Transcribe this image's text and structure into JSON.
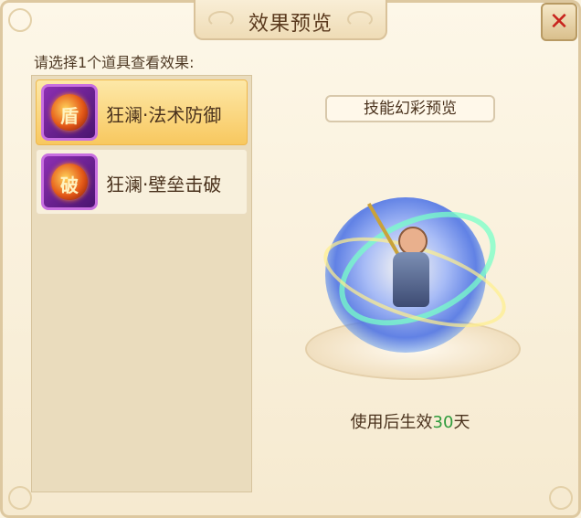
{
  "dialog": {
    "title": "效果预览",
    "close_icon": "close-icon",
    "prompt": "请选择1个道具查看效果:"
  },
  "items": [
    {
      "label": "狂澜·法术防御",
      "icon": "magic-defense-icon",
      "selected": true
    },
    {
      "label": "狂澜·壁垒击破",
      "icon": "barrier-break-icon",
      "selected": false
    }
  ],
  "preview": {
    "pill_label": "技能幻彩预览",
    "effect_prefix": "使用后生效",
    "effect_days": "30",
    "effect_suffix": "天"
  },
  "colors": {
    "accent_green": "#2f9b3c",
    "close_red": "#c8231d",
    "selected_bg": "#f8c85f"
  }
}
